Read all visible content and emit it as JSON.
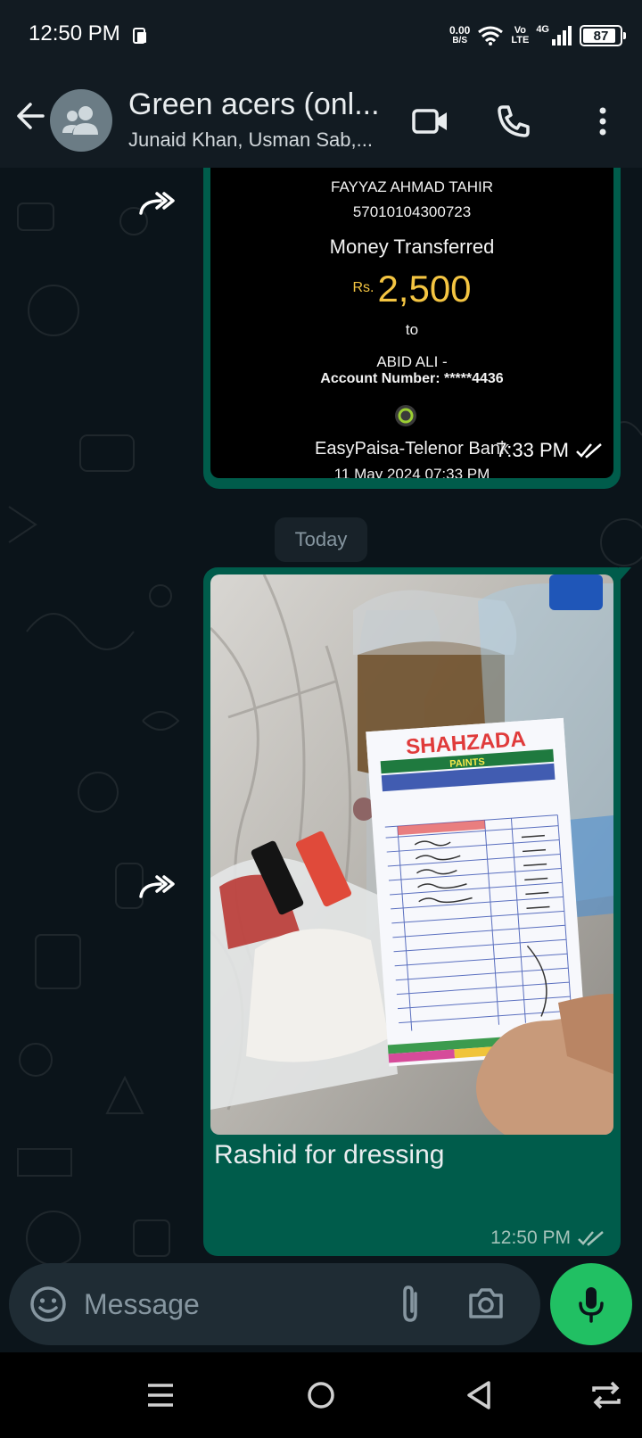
{
  "status_bar": {
    "time": "12:50 PM",
    "net_speed_value": "0.00",
    "net_speed_unit": "B/S",
    "volte_top": "Vo",
    "volte_bottom": "LTE",
    "network": "4G",
    "battery": "87"
  },
  "header": {
    "title": "Green acers (onl...",
    "subtitle": "Junaid Khan, Usman Sab,..."
  },
  "messages": {
    "first": {
      "receipt": {
        "sender_name": "FAYYAZ AHMAD TAHIR",
        "sender_account": "57010104300723",
        "heading": "Money Transferred",
        "currency": "Rs.",
        "amount": "2,500",
        "to": "to",
        "recipient": "ABID ALI -",
        "account_line": "Account Number: *****4436",
        "bank": "EasyPaisa-Telenor Bank",
        "date_partial": "11 May 2024 07:33 PM"
      },
      "time": "7:33 PM"
    },
    "date_divider": "Today",
    "second": {
      "receipt_brand": "SHAHZADA",
      "receipt_sub": "PAINTS",
      "caption": "Rashid for dressing",
      "time": "12:50 PM"
    }
  },
  "composer": {
    "placeholder": "Message"
  },
  "colors": {
    "app_bg": "#0b141a",
    "header_bg": "#121b22",
    "outgoing_bubble": "#005c4b",
    "mic_button": "#21c063",
    "composer_bg": "#1f2c34"
  },
  "icons": {
    "back": "arrow-left-icon",
    "group": "group-avatar-icon",
    "video": "video-call-icon",
    "call": "phone-icon",
    "menu": "more-vert-icon",
    "forward": "forward-icon",
    "read": "double-check-icon",
    "emoji": "emoji-icon",
    "attach": "paperclip-icon",
    "camera": "camera-icon",
    "mic": "mic-icon"
  }
}
